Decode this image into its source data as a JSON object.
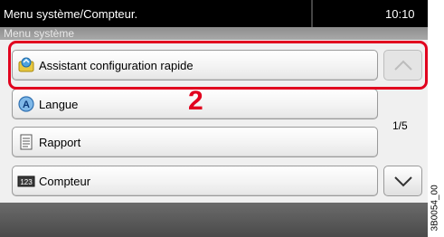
{
  "header": {
    "title": "Menu système/Compteur.",
    "clock": "10:10",
    "subtitle": "Menu système"
  },
  "menu_items": [
    {
      "label": "Assistant configuration rapide",
      "icon": "wizard-icon"
    },
    {
      "label": "Langue",
      "icon": "language-icon"
    },
    {
      "label": "Rapport",
      "icon": "report-icon"
    },
    {
      "label": "Compteur",
      "icon": "counter-icon"
    }
  ],
  "icons": {
    "counter_glyph": "123"
  },
  "pagination": {
    "page": "1/5"
  },
  "annotation": {
    "step_number": "2",
    "highlight_color": "#e1001e"
  },
  "figure_code": "3B0054_00"
}
